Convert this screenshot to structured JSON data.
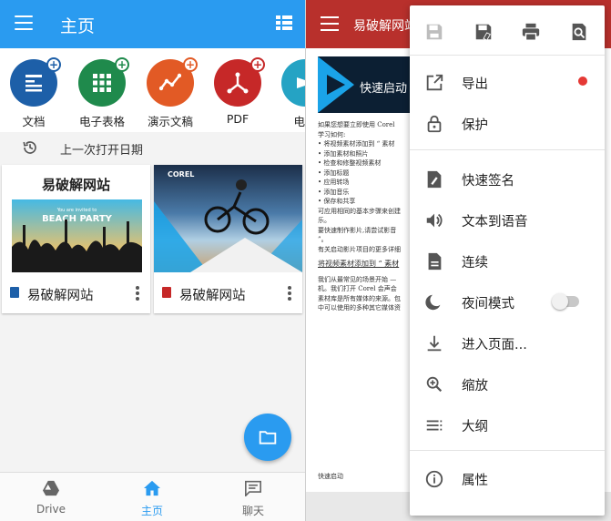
{
  "left": {
    "header": {
      "title": "主页"
    },
    "categories": [
      {
        "label": "文档",
        "color": "#1d5fa8",
        "icon": "document-icon"
      },
      {
        "label": "电子表格",
        "color": "#1f8a4c",
        "icon": "spreadsheet-icon"
      },
      {
        "label": "演示文稿",
        "color": "#e25a25",
        "icon": "presentation-icon"
      },
      {
        "label": "PDF",
        "color": "#c62828",
        "icon": "pdf-icon"
      },
      {
        "label": "电子",
        "color": "#25a3c4",
        "icon": "ebook-icon"
      }
    ],
    "recent_label": "上一次打开日期",
    "cards": [
      {
        "name": "易破解网站",
        "thumb_title": "易破解网站",
        "thumb_line1": "You are invited to",
        "thumb_line2": "BEACH PARTY"
      },
      {
        "name": "易破解网站",
        "thumb_brand": "COREL"
      }
    ],
    "bottom_nav": [
      {
        "label": "Drive",
        "icon": "drive-icon"
      },
      {
        "label": "主页",
        "icon": "home-icon"
      },
      {
        "label": "聊天",
        "icon": "chat-icon"
      }
    ]
  },
  "right": {
    "header": {
      "title": "易破解网站"
    },
    "doc": {
      "banner": "快速启动",
      "lines": [
        "如果您想要立即使用 Corel",
        "学习如何:",
        "• 将视频素材添加到 “ 素材",
        "• 添加素材和照片",
        "• 检查和修整视频素材",
        "• 添加标题",
        "• 应用转场",
        "• 添加音乐",
        "• 保存和共享",
        "可应用相同的基本步骤来创建",
        "乐。",
        "要快速制作影片,请尝试影音",
        "”。",
        "有关启动影片项目的更多详细"
      ],
      "heading": "将视频素材添加到 “ 素材",
      "lines2": [
        "我们从最常见的场景开始 —",
        "机。我们打开 Corel 会声会",
        "素材库是所有媒体的来源。包",
        "中可以使用的多种其它媒体资"
      ],
      "footer": "快速启动"
    },
    "menu": {
      "toolbar": [
        "save-icon",
        "save-as-icon",
        "print-icon",
        "find-icon"
      ],
      "items": [
        {
          "label": "导出",
          "icon": "export-icon"
        },
        {
          "label": "保护",
          "icon": "lock-icon"
        },
        {
          "label": "快速签名",
          "icon": "signature-icon"
        },
        {
          "label": "文本到语音",
          "icon": "speaker-icon"
        },
        {
          "label": "连续",
          "icon": "page-icon"
        },
        {
          "label": "夜间模式",
          "icon": "moon-icon"
        },
        {
          "label": "进入页面...",
          "icon": "goto-page-icon"
        },
        {
          "label": "缩放",
          "icon": "zoom-icon"
        },
        {
          "label": "大纲",
          "icon": "outline-icon"
        },
        {
          "label": "属性",
          "icon": "info-icon"
        }
      ]
    }
  }
}
